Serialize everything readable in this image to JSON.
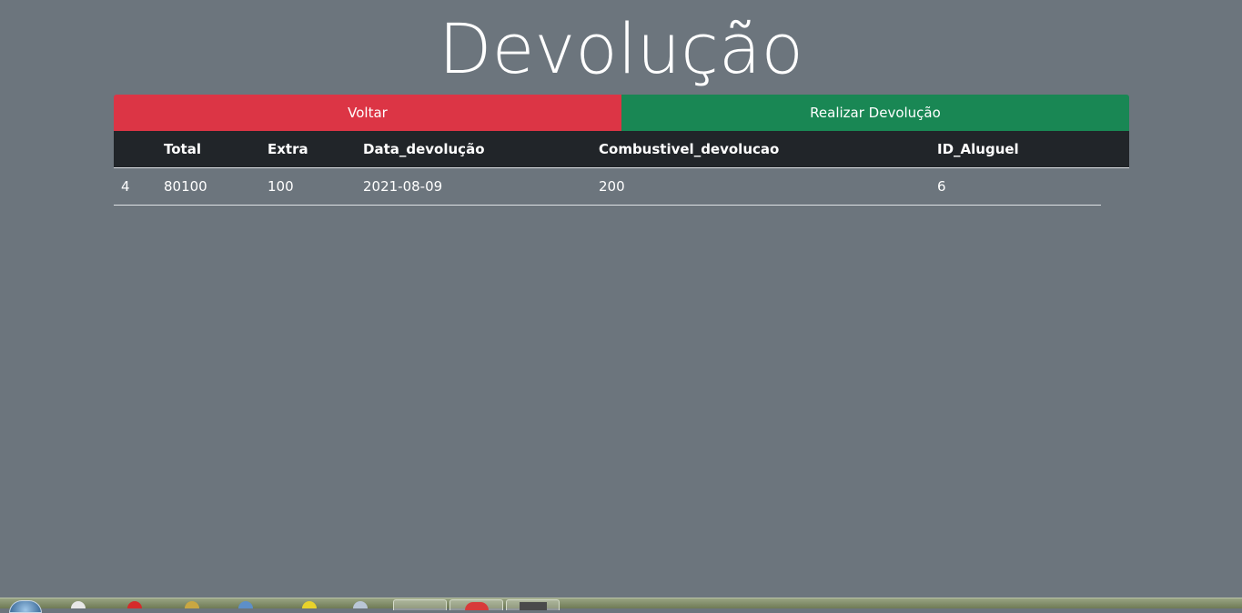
{
  "page": {
    "title": "Devolução"
  },
  "actions": {
    "back_label": "Voltar",
    "submit_label": "Realizar Devolução"
  },
  "table": {
    "columns": [
      "",
      "Total",
      "Extra",
      "Data_devolução",
      "Combustivel_devolucao",
      "ID_Aluguel"
    ],
    "rows": [
      [
        "4",
        "80100",
        "100",
        "2021-08-09",
        "200",
        "6"
      ]
    ]
  },
  "colors": {
    "background": "#6c757d",
    "back_button": "#dc3545",
    "submit_button": "#198754",
    "table_header": "#212529"
  },
  "taskbar": {
    "icons": [
      "windows-start-icon",
      "folder-icon",
      "opera-icon",
      "paint-icon",
      "media-icon",
      "shortcut-icon",
      "document-icon",
      "explorer-task-icon",
      "record-task-icon",
      "terminal-task-icon"
    ]
  }
}
